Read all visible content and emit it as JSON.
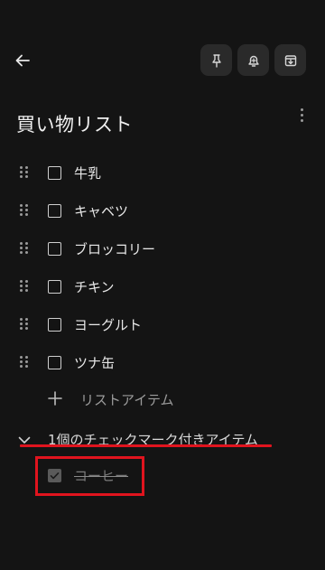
{
  "header": {
    "back_icon": "arrow-left-icon",
    "actions": [
      {
        "icon": "pin-icon"
      },
      {
        "icon": "reminder-bell-icon"
      },
      {
        "icon": "archive-icon"
      }
    ],
    "more_icon": "more-vertical-icon"
  },
  "note": {
    "title": "買い物リスト",
    "items": [
      {
        "label": "牛乳",
        "checked": false
      },
      {
        "label": "キャベツ",
        "checked": false
      },
      {
        "label": "ブロッコリー",
        "checked": false
      },
      {
        "label": "チキン",
        "checked": false
      },
      {
        "label": "ヨーグルト",
        "checked": false
      },
      {
        "label": "ツナ缶",
        "checked": false
      }
    ],
    "add_item_label": "リストアイテム",
    "checked_section_title": "1個のチェックマーク付きアイテム",
    "checked_items": [
      {
        "label": "コーヒー",
        "checked": true
      }
    ]
  },
  "colors": {
    "background": "#141414",
    "annotation_red": "#e0141e"
  }
}
